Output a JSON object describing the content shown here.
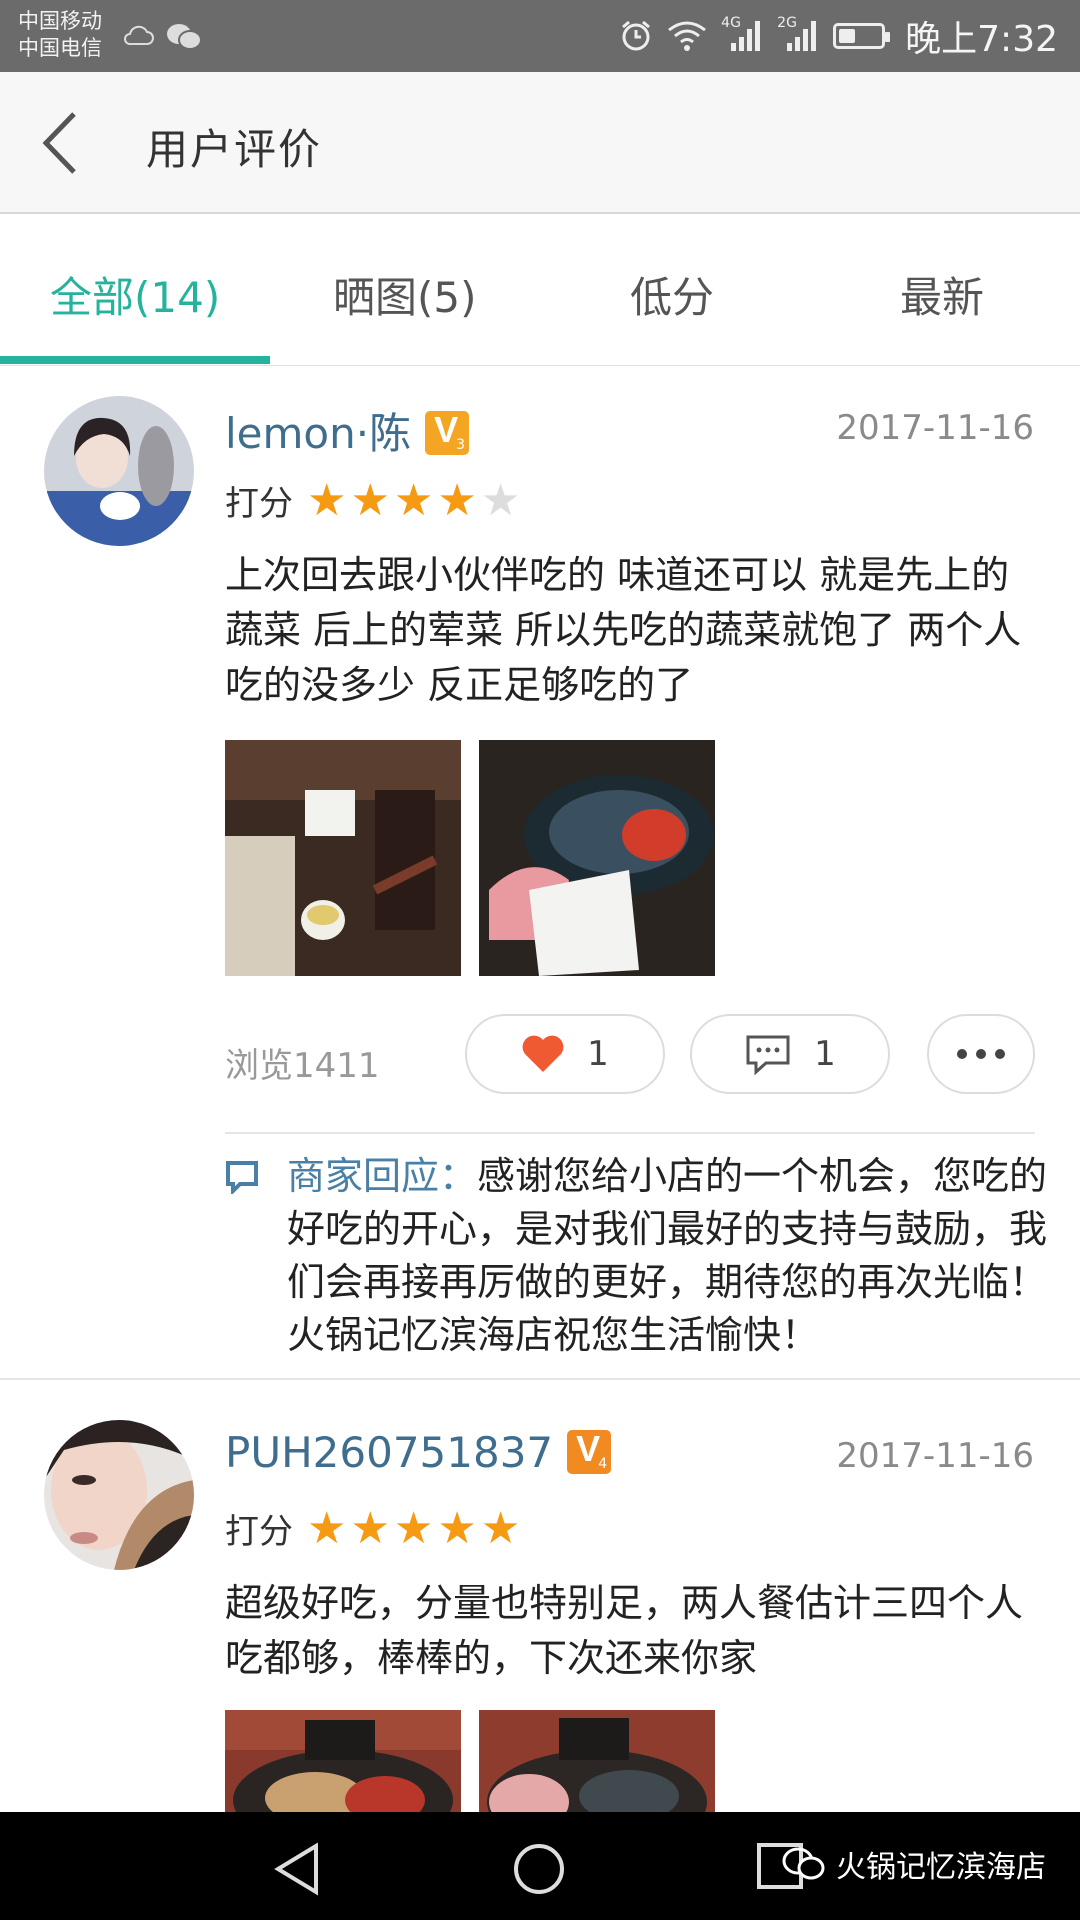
{
  "status_bar": {
    "carrier_1": "中国移动",
    "carrier_2": "中国电信",
    "network_1": "4G",
    "network_2": "2G",
    "time": "晚上7:32"
  },
  "app_bar": {
    "back_icon": "chevron-left-icon",
    "title": "用户评价"
  },
  "tabs": [
    {
      "label": "全部(14)",
      "active": true
    },
    {
      "label": "晒图(5)",
      "active": false
    },
    {
      "label": "低分",
      "active": false
    },
    {
      "label": "最新",
      "active": false
    }
  ],
  "reviews": [
    {
      "username": "lemon·陈",
      "level": "3",
      "date": "2017-11-16",
      "rating_label": "打分",
      "rating": 4,
      "text": "上次回去跟小伙伴吃的 味道还可以 就是先上的蔬菜 后上的荤菜 所以先吃的蔬菜就饱了 两个人吃的没多少 反正足够吃的了",
      "photo_count": 2,
      "views": "浏览1411",
      "likes": "1",
      "comments": "1",
      "reply_label": "商家回应：",
      "reply_text": "感谢您给小店的一个机会，您吃的好吃的开心，是对我们最好的支持与鼓励，我们会再接再厉做的更好，期待您的再次光临！火锅记忆滨海店祝您生活愉快！"
    },
    {
      "username": "PUH260751837",
      "level": "4",
      "date": "2017-11-16",
      "rating_label": "打分",
      "rating": 5,
      "text": "超级好吃，分量也特别足，两人餐估计三四个人吃都够，棒棒的，下次还来你家",
      "photo_count": 2
    }
  ],
  "nav_bar": {
    "watermark": "火锅记忆滨海店"
  },
  "colors": {
    "accent": "#25b39e",
    "username": "#3f6d8e",
    "star": "#f59a12",
    "status_bar": "#6b6b6b"
  }
}
